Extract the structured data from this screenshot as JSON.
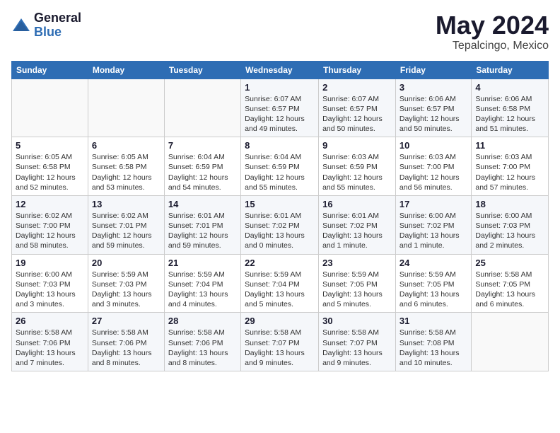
{
  "header": {
    "logo_general": "General",
    "logo_blue": "Blue",
    "month": "May 2024",
    "location": "Tepalcingo, Mexico"
  },
  "days_of_week": [
    "Sunday",
    "Monday",
    "Tuesday",
    "Wednesday",
    "Thursday",
    "Friday",
    "Saturday"
  ],
  "weeks": [
    [
      {
        "day": "",
        "info": ""
      },
      {
        "day": "",
        "info": ""
      },
      {
        "day": "",
        "info": ""
      },
      {
        "day": "1",
        "info": "Sunrise: 6:07 AM\nSunset: 6:57 PM\nDaylight: 12 hours\nand 49 minutes."
      },
      {
        "day": "2",
        "info": "Sunrise: 6:07 AM\nSunset: 6:57 PM\nDaylight: 12 hours\nand 50 minutes."
      },
      {
        "day": "3",
        "info": "Sunrise: 6:06 AM\nSunset: 6:57 PM\nDaylight: 12 hours\nand 50 minutes."
      },
      {
        "day": "4",
        "info": "Sunrise: 6:06 AM\nSunset: 6:58 PM\nDaylight: 12 hours\nand 51 minutes."
      }
    ],
    [
      {
        "day": "5",
        "info": "Sunrise: 6:05 AM\nSunset: 6:58 PM\nDaylight: 12 hours\nand 52 minutes."
      },
      {
        "day": "6",
        "info": "Sunrise: 6:05 AM\nSunset: 6:58 PM\nDaylight: 12 hours\nand 53 minutes."
      },
      {
        "day": "7",
        "info": "Sunrise: 6:04 AM\nSunset: 6:59 PM\nDaylight: 12 hours\nand 54 minutes."
      },
      {
        "day": "8",
        "info": "Sunrise: 6:04 AM\nSunset: 6:59 PM\nDaylight: 12 hours\nand 55 minutes."
      },
      {
        "day": "9",
        "info": "Sunrise: 6:03 AM\nSunset: 6:59 PM\nDaylight: 12 hours\nand 55 minutes."
      },
      {
        "day": "10",
        "info": "Sunrise: 6:03 AM\nSunset: 7:00 PM\nDaylight: 12 hours\nand 56 minutes."
      },
      {
        "day": "11",
        "info": "Sunrise: 6:03 AM\nSunset: 7:00 PM\nDaylight: 12 hours\nand 57 minutes."
      }
    ],
    [
      {
        "day": "12",
        "info": "Sunrise: 6:02 AM\nSunset: 7:00 PM\nDaylight: 12 hours\nand 58 minutes."
      },
      {
        "day": "13",
        "info": "Sunrise: 6:02 AM\nSunset: 7:01 PM\nDaylight: 12 hours\nand 59 minutes."
      },
      {
        "day": "14",
        "info": "Sunrise: 6:01 AM\nSunset: 7:01 PM\nDaylight: 12 hours\nand 59 minutes."
      },
      {
        "day": "15",
        "info": "Sunrise: 6:01 AM\nSunset: 7:02 PM\nDaylight: 13 hours\nand 0 minutes."
      },
      {
        "day": "16",
        "info": "Sunrise: 6:01 AM\nSunset: 7:02 PM\nDaylight: 13 hours\nand 1 minute."
      },
      {
        "day": "17",
        "info": "Sunrise: 6:00 AM\nSunset: 7:02 PM\nDaylight: 13 hours\nand 1 minute."
      },
      {
        "day": "18",
        "info": "Sunrise: 6:00 AM\nSunset: 7:03 PM\nDaylight: 13 hours\nand 2 minutes."
      }
    ],
    [
      {
        "day": "19",
        "info": "Sunrise: 6:00 AM\nSunset: 7:03 PM\nDaylight: 13 hours\nand 3 minutes."
      },
      {
        "day": "20",
        "info": "Sunrise: 5:59 AM\nSunset: 7:03 PM\nDaylight: 13 hours\nand 3 minutes."
      },
      {
        "day": "21",
        "info": "Sunrise: 5:59 AM\nSunset: 7:04 PM\nDaylight: 13 hours\nand 4 minutes."
      },
      {
        "day": "22",
        "info": "Sunrise: 5:59 AM\nSunset: 7:04 PM\nDaylight: 13 hours\nand 5 minutes."
      },
      {
        "day": "23",
        "info": "Sunrise: 5:59 AM\nSunset: 7:05 PM\nDaylight: 13 hours\nand 5 minutes."
      },
      {
        "day": "24",
        "info": "Sunrise: 5:59 AM\nSunset: 7:05 PM\nDaylight: 13 hours\nand 6 minutes."
      },
      {
        "day": "25",
        "info": "Sunrise: 5:58 AM\nSunset: 7:05 PM\nDaylight: 13 hours\nand 6 minutes."
      }
    ],
    [
      {
        "day": "26",
        "info": "Sunrise: 5:58 AM\nSunset: 7:06 PM\nDaylight: 13 hours\nand 7 minutes."
      },
      {
        "day": "27",
        "info": "Sunrise: 5:58 AM\nSunset: 7:06 PM\nDaylight: 13 hours\nand 8 minutes."
      },
      {
        "day": "28",
        "info": "Sunrise: 5:58 AM\nSunset: 7:06 PM\nDaylight: 13 hours\nand 8 minutes."
      },
      {
        "day": "29",
        "info": "Sunrise: 5:58 AM\nSunset: 7:07 PM\nDaylight: 13 hours\nand 9 minutes."
      },
      {
        "day": "30",
        "info": "Sunrise: 5:58 AM\nSunset: 7:07 PM\nDaylight: 13 hours\nand 9 minutes."
      },
      {
        "day": "31",
        "info": "Sunrise: 5:58 AM\nSunset: 7:08 PM\nDaylight: 13 hours\nand 10 minutes."
      },
      {
        "day": "",
        "info": ""
      }
    ]
  ]
}
